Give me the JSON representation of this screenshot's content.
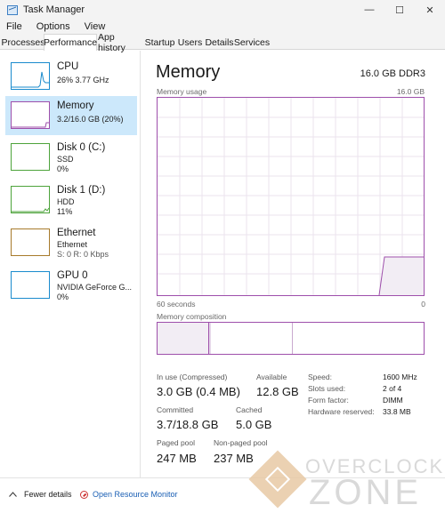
{
  "window": {
    "title": "Task Manager",
    "controls": {
      "minimize": "—",
      "maximize": "☐",
      "close": "✕"
    }
  },
  "menu": [
    "File",
    "Options",
    "View"
  ],
  "tabs": [
    "Processes",
    "Performance",
    "App history",
    "Startup",
    "Users",
    "Details",
    "Services"
  ],
  "active_tab": "Performance",
  "sidebar": [
    {
      "name": "CPU",
      "line1": "26% 3.77 GHz",
      "line2": "",
      "color": "#1a8bcd",
      "selected": false
    },
    {
      "name": "Memory",
      "line1": "3.2/16.0 GB (20%)",
      "line2": "",
      "color": "#9e4fab",
      "selected": true
    },
    {
      "name": "Disk 0 (C:)",
      "line1": "SSD",
      "line2": "0%",
      "color": "#4da33b",
      "selected": false
    },
    {
      "name": "Disk 1 (D:)",
      "line1": "HDD",
      "line2": "11%",
      "color": "#4da33b",
      "selected": false
    },
    {
      "name": "Ethernet",
      "line1": "Ethernet",
      "line2": "S: 0 R: 0 Kbps",
      "color": "#a77a2b",
      "selected": false
    },
    {
      "name": "GPU 0",
      "line1": "NVIDIA GeForce G...",
      "line2": "0%",
      "color": "#1a8bcd",
      "selected": false
    }
  ],
  "main": {
    "title": "Memory",
    "spec": "16.0 GB DDR3",
    "usage_label": "Memory usage",
    "usage_max": "16.0 GB",
    "time_left": "60 seconds",
    "time_right": "0",
    "composition_label": "Memory composition",
    "stats": {
      "in_use_label": "In use (Compressed)",
      "in_use_value": "3.0 GB (0.4 MB)",
      "available_label": "Available",
      "available_value": "12.8 GB",
      "committed_label": "Committed",
      "committed_value": "3.7/18.8 GB",
      "cached_label": "Cached",
      "cached_value": "5.0 GB",
      "paged_label": "Paged pool",
      "paged_value": "247 MB",
      "nonpaged_label": "Non-paged pool",
      "nonpaged_value": "237 MB"
    },
    "details": [
      {
        "key": "Speed:",
        "value": "1600 MHz"
      },
      {
        "key": "Slots used:",
        "value": "2 of 4"
      },
      {
        "key": "Form factor:",
        "value": "DIMM"
      },
      {
        "key": "Hardware reserved:",
        "value": "33.8 MB"
      }
    ]
  },
  "footer": {
    "fewer_details": "Fewer details",
    "open_resource_monitor": "Open Resource Monitor"
  },
  "watermark": {
    "top": "OVERCLOCK",
    "bottom": "ZONE"
  }
}
